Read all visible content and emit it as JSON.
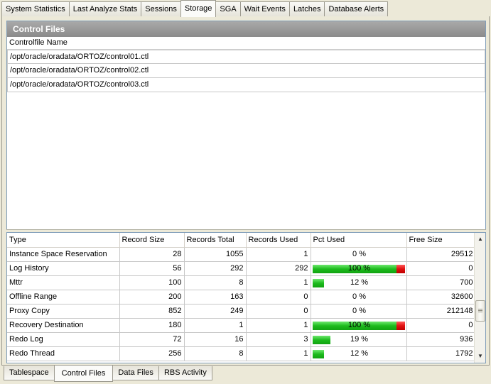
{
  "top_tabs": [
    {
      "label": "System Statistics",
      "active": false
    },
    {
      "label": "Last Analyze Stats",
      "active": false
    },
    {
      "label": "Sessions",
      "active": false
    },
    {
      "label": "Storage",
      "active": true
    },
    {
      "label": "SGA",
      "active": false
    },
    {
      "label": "Wait Events",
      "active": false
    },
    {
      "label": "Latches",
      "active": false
    },
    {
      "label": "Database Alerts",
      "active": false
    }
  ],
  "control_files": {
    "title": "Control Files",
    "column_header": "Controlfile Name",
    "rows": [
      "/opt/oracle/oradata/ORTOZ/control01.ctl",
      "/opt/oracle/oradata/ORTOZ/control02.ctl",
      "/opt/oracle/oradata/ORTOZ/control03.ctl"
    ]
  },
  "records_table": {
    "columns": [
      "Type",
      "Record Size",
      "Records Total",
      "Records Used",
      "Pct Used",
      "Free Size"
    ],
    "rows": [
      {
        "type": "Instance Space Reservation",
        "record_size": "28",
        "records_total": "1055",
        "records_used": "1",
        "pct_used": "0 %",
        "pct_value": 0,
        "free_size": "29512"
      },
      {
        "type": "Log History",
        "record_size": "56",
        "records_total": "292",
        "records_used": "292",
        "pct_used": "100 %",
        "pct_value": 100,
        "free_size": "0"
      },
      {
        "type": "Mttr",
        "record_size": "100",
        "records_total": "8",
        "records_used": "1",
        "pct_used": "12 %",
        "pct_value": 12,
        "free_size": "700"
      },
      {
        "type": "Offline Range",
        "record_size": "200",
        "records_total": "163",
        "records_used": "0",
        "pct_used": "0 %",
        "pct_value": 0,
        "free_size": "32600"
      },
      {
        "type": "Proxy Copy",
        "record_size": "852",
        "records_total": "249",
        "records_used": "0",
        "pct_used": "0 %",
        "pct_value": 0,
        "free_size": "212148"
      },
      {
        "type": "Recovery Destination",
        "record_size": "180",
        "records_total": "1",
        "records_used": "1",
        "pct_used": "100 %",
        "pct_value": 100,
        "free_size": "0"
      },
      {
        "type": "Redo Log",
        "record_size": "72",
        "records_total": "16",
        "records_used": "3",
        "pct_used": "19 %",
        "pct_value": 19,
        "free_size": "936"
      },
      {
        "type": "Redo Thread",
        "record_size": "256",
        "records_total": "8",
        "records_used": "1",
        "pct_used": "12 %",
        "pct_value": 12,
        "free_size": "1792"
      }
    ]
  },
  "scrollbar": {
    "up_icon": "arrow-up-icon",
    "down_icon": "arrow-down-icon"
  },
  "bottom_tabs": [
    {
      "label": "Tablespace",
      "active": false
    },
    {
      "label": "Control Files",
      "active": true
    },
    {
      "label": "Data Files",
      "active": false
    },
    {
      "label": "RBS Activity",
      "active": false
    }
  ],
  "colors": {
    "bar_green": "#1dbb1d",
    "bar_red": "#e01010",
    "header_gray": "#999999"
  }
}
